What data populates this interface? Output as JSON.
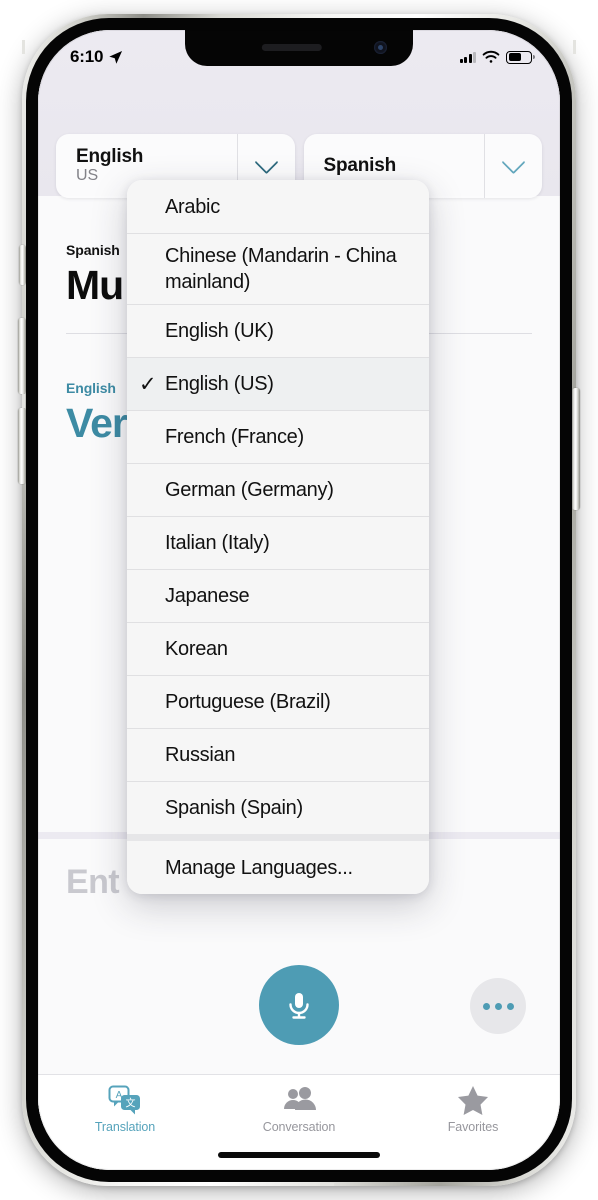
{
  "status_bar": {
    "time": "6:10",
    "location_icon": "location-arrow-icon",
    "cellular_icon": "signal-bars-icon",
    "wifi_icon": "wifi-icon",
    "battery_icon": "battery-icon"
  },
  "language_selectors": {
    "source": {
      "primary": "English",
      "secondary": "US",
      "chevron_icon": "chevron-down-icon"
    },
    "target": {
      "primary": "Spanish",
      "secondary": "",
      "chevron_icon": "chevron-down-icon"
    }
  },
  "translation_card": {
    "source_label": "Spanish",
    "source_text": "Mu",
    "target_label": "English",
    "target_text": "Ver",
    "expand_icon": "expand-arrows-icon",
    "play_icon": "play-icon"
  },
  "entry": {
    "placeholder": "Ent"
  },
  "controls": {
    "mic_icon": "microphone-icon",
    "more_icon": "more-dots-icon"
  },
  "dropdown": {
    "items": [
      {
        "label": "Arabic",
        "selected": false
      },
      {
        "label": "Chinese (Mandarin - China mainland)",
        "selected": false
      },
      {
        "label": "English (UK)",
        "selected": false
      },
      {
        "label": "English (US)",
        "selected": true
      },
      {
        "label": "French (France)",
        "selected": false
      },
      {
        "label": "German (Germany)",
        "selected": false
      },
      {
        "label": "Italian (Italy)",
        "selected": false
      },
      {
        "label": "Japanese",
        "selected": false
      },
      {
        "label": "Korean",
        "selected": false
      },
      {
        "label": "Portuguese (Brazil)",
        "selected": false
      },
      {
        "label": "Russian",
        "selected": false
      },
      {
        "label": "Spanish (Spain)",
        "selected": false
      }
    ],
    "footer_item": "Manage Languages...",
    "check_glyph": "✓"
  },
  "tab_bar": {
    "tabs": [
      {
        "label": "Translation",
        "icon": "translation-bubbles-icon",
        "active": true
      },
      {
        "label": "Conversation",
        "icon": "people-icon",
        "active": false
      },
      {
        "label": "Favorites",
        "icon": "star-icon",
        "active": false
      }
    ]
  },
  "colors": {
    "accent_teal": "#4e9cb4",
    "label_teal": "#3d8ba4",
    "tab_active": "#56a3bb",
    "menu_bg": "#f6f6f6",
    "selected_row": "#eef0f1"
  }
}
